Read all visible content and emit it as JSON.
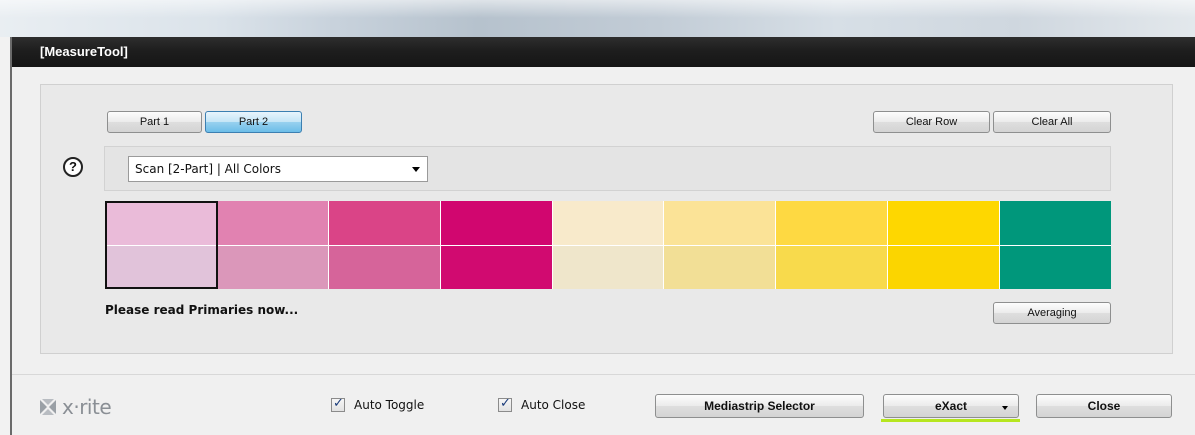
{
  "window": {
    "title": "[MeasureTool]"
  },
  "parts": [
    {
      "label": "Part 1",
      "active": false
    },
    {
      "label": "Part 2",
      "active": true
    }
  ],
  "row_actions": {
    "clear_row": "Clear Row",
    "clear_all": "Clear All"
  },
  "help": {
    "symbol": "?"
  },
  "scan_mode": {
    "selected": "Scan [2-Part] | All Colors"
  },
  "swatches": {
    "top": [
      "#eabbd9",
      "#e182b1",
      "#da4487",
      "#d1066f",
      "#f8eacb",
      "#fbe397",
      "#fed942",
      "#fed700",
      "#00977b"
    ],
    "bottom": [
      "#e1c3da",
      "#db97ba",
      "#d6649a",
      "#d10a70",
      "#efe6cb",
      "#f2df96",
      "#f8da4c",
      "#fbd500",
      "#00977b"
    ],
    "selected_index": 0
  },
  "status": "Please read Primaries now...",
  "averaging": "Averaging",
  "brand": {
    "name": "x·rite"
  },
  "options": [
    {
      "label": "Auto Toggle",
      "checked": true
    },
    {
      "label": "Auto Close",
      "checked": true
    }
  ],
  "footer_buttons": {
    "mediastrip": "Mediastrip Selector",
    "device": "eXact",
    "close": "Close"
  },
  "colors": {
    "accent_underline": "#b6e61f",
    "active_button": "#98d1ef"
  }
}
